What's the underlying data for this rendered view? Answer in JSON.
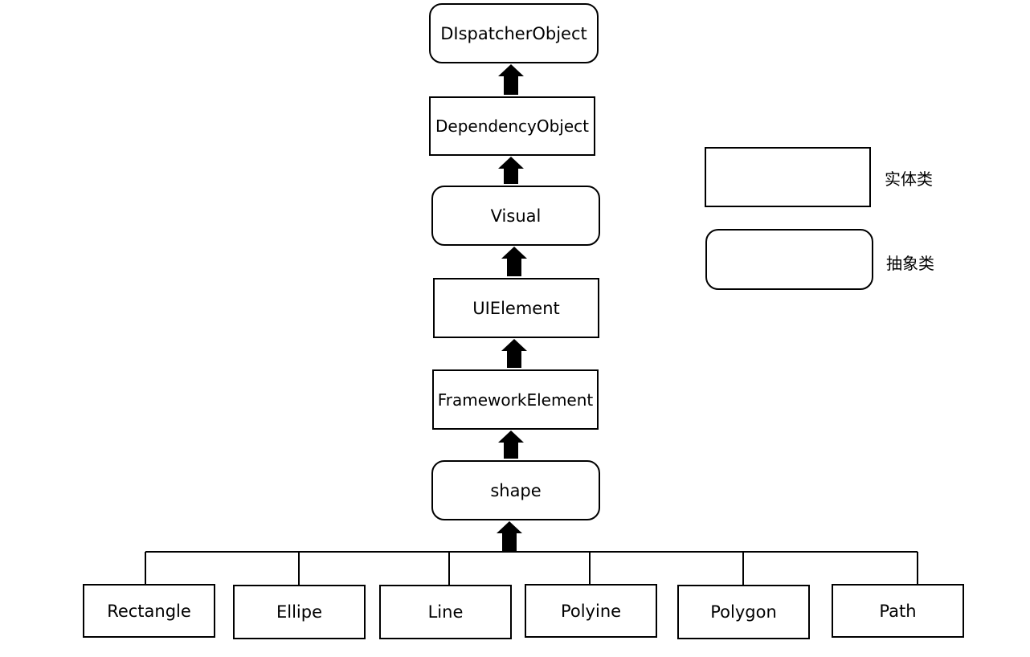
{
  "hierarchy": [
    {
      "name": "DIspatcherObject",
      "kind": "abstract"
    },
    {
      "name": "DependencyObject",
      "kind": "concrete"
    },
    {
      "name": "Visual",
      "kind": "abstract"
    },
    {
      "name": "UIElement",
      "kind": "concrete"
    },
    {
      "name": "FrameworkElement",
      "kind": "concrete"
    },
    {
      "name": "shape",
      "kind": "abstract"
    }
  ],
  "children": [
    "Rectangle",
    "Ellipe",
    "Line",
    "Polyine",
    "Polygon",
    "Path"
  ],
  "legend": {
    "concrete_label": "实体类",
    "abstract_label": "抽象类"
  }
}
